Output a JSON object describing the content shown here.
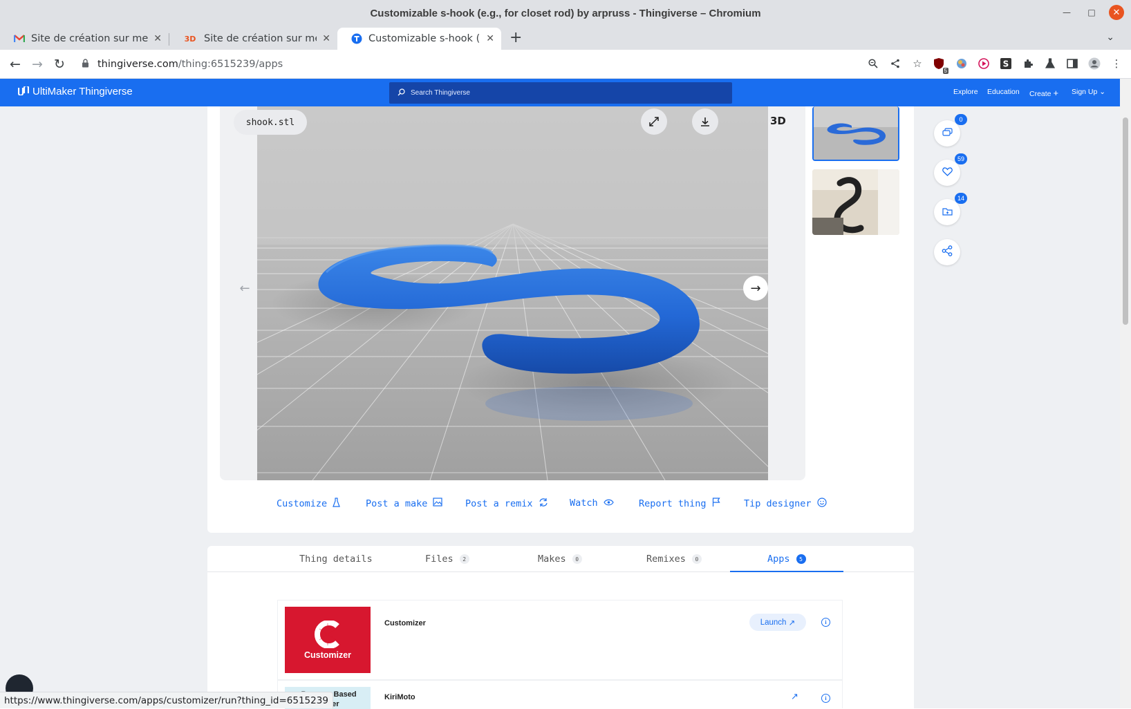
{
  "window": {
    "title": "Customizable s-hook (e.g., for closet rod) by arpruss - Thingiverse – Chromium"
  },
  "tabs": [
    {
      "label": "Site de création sur mesure",
      "favicon": "gmail-icon"
    },
    {
      "label": "Site de création sur mesure",
      "favicon": "3d-icon",
      "favicon_text": "3D"
    },
    {
      "label": "Customizable s-hook (e.g., for closet rod)",
      "favicon": "thingiverse-icon"
    }
  ],
  "toolbar": {
    "url_host": "thingiverse.com",
    "url_path": "/thing:6515239/apps"
  },
  "extensions": {
    "ublock_badge": "5"
  },
  "header": {
    "logo": "UltiMaker Thingiverse",
    "search_placeholder": "Search Thingiverse",
    "nav": [
      "Explore",
      "Education",
      "Create",
      "Sign Up"
    ]
  },
  "viewer": {
    "file_name": "shook.stl",
    "mode_label": "3D"
  },
  "actions": [
    {
      "label": "Customize",
      "icon": "flask-icon"
    },
    {
      "label": "Post a make",
      "icon": "image-icon"
    },
    {
      "label": "Post a remix",
      "icon": "remix-icon"
    },
    {
      "label": "Watch",
      "icon": "eye-icon"
    },
    {
      "label": "Report thing",
      "icon": "flag-icon"
    },
    {
      "label": "Tip designer",
      "icon": "smiley-icon"
    }
  ],
  "social": {
    "comments": "0",
    "likes": "59",
    "collections": "14"
  },
  "page_tabs": [
    {
      "label": "Thing details",
      "count": ""
    },
    {
      "label": "Files",
      "count": "2"
    },
    {
      "label": "Makes",
      "count": "0"
    },
    {
      "label": "Remixes",
      "count": "0"
    },
    {
      "label": "Apps",
      "count": "5"
    }
  ],
  "apps": [
    {
      "name": "Customizer",
      "logo_text": "Customizer",
      "launch_label": "Launch"
    },
    {
      "name": "KiriMoto",
      "logo_text": "Browser Based Slicer"
    }
  ],
  "status_bar": {
    "url": "https://www.thingiverse.com/apps/customizer/run?thing_id=6515239"
  },
  "colors": {
    "brand": "#196ef0",
    "customizer_red": "#d7172f"
  }
}
